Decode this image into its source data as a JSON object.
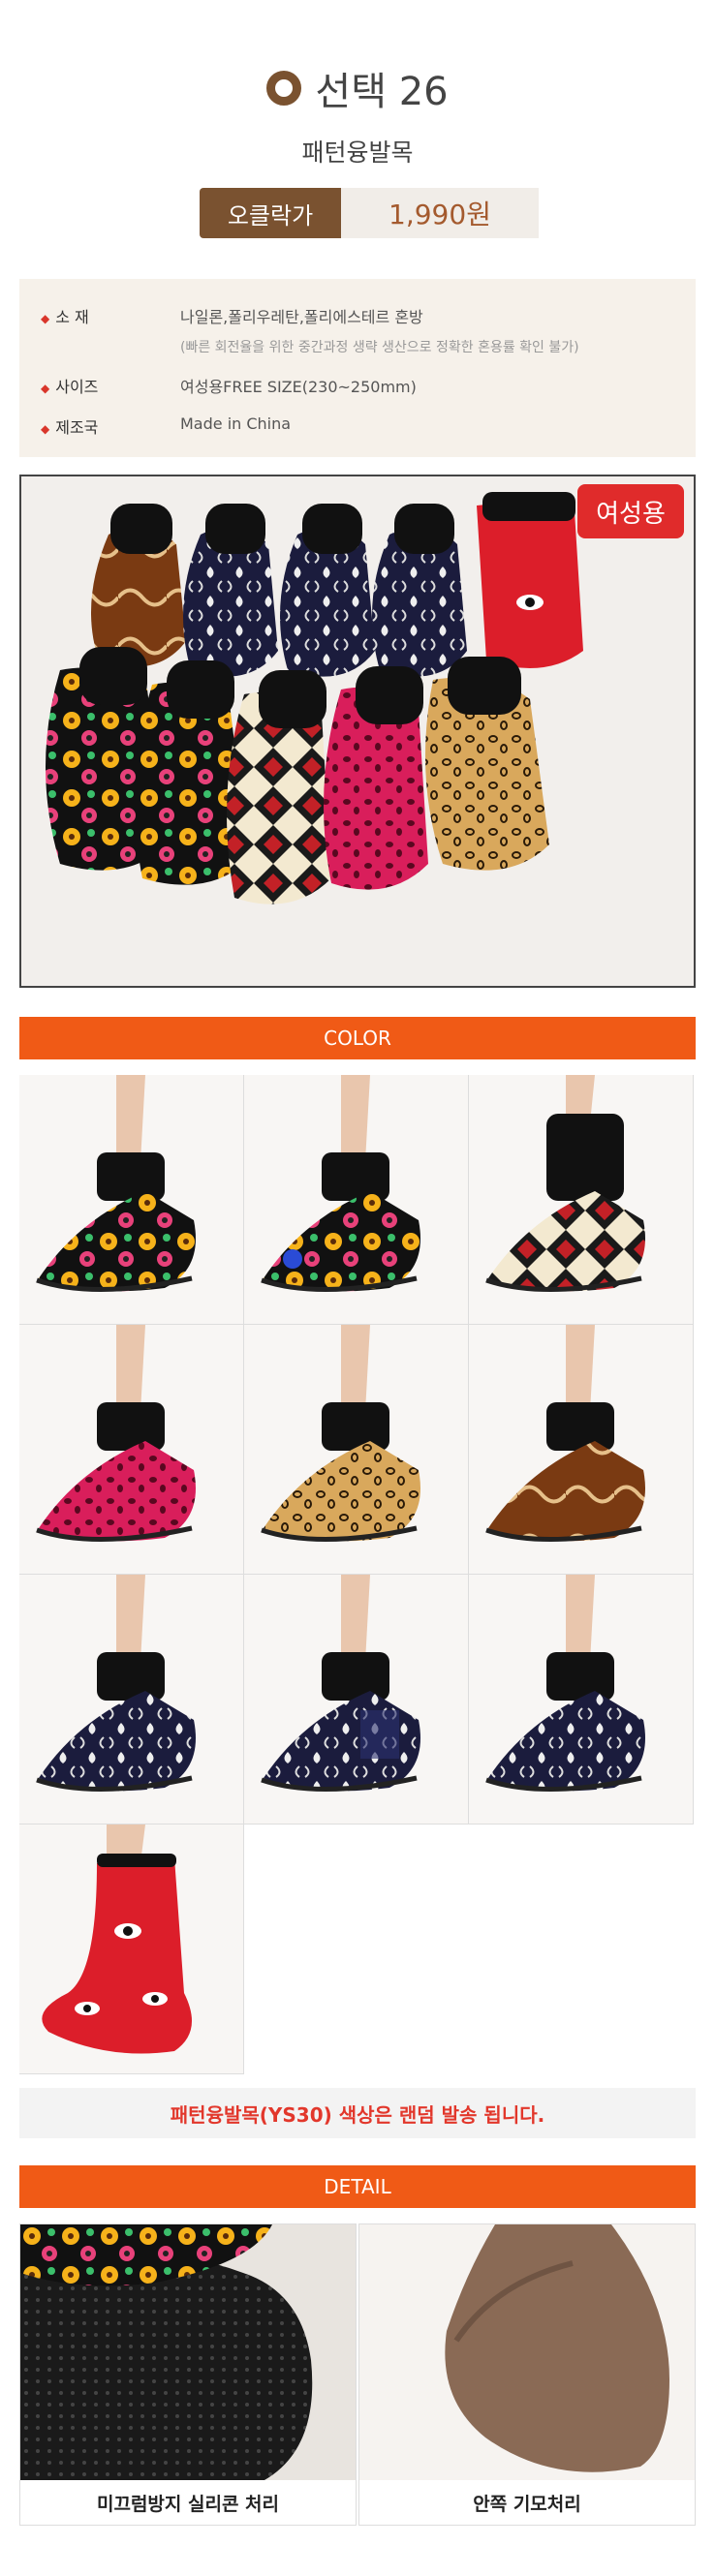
{
  "header": {
    "title": "선택 26",
    "subtitle": "패턴융발목",
    "price_label": "오클락가",
    "price_value": "1,990원"
  },
  "info": {
    "rows": [
      {
        "key": "소   재",
        "value": "나일론,폴리우레탄,폴리에스테르 혼방",
        "note": "(빠른 회전율을 위한 중간과정 생략 생산으로 정확한 혼용률 확인 불가)"
      },
      {
        "key": "사이즈",
        "value": "여성용FREE SIZE(230~250mm)"
      },
      {
        "key": "제조국",
        "value": "Made in China"
      }
    ]
  },
  "photo": {
    "tag": "여성용"
  },
  "sections": {
    "color_title": "COLOR",
    "detail_title": "DETAIL"
  },
  "notice": "패턴융발목(YS30) 색상은 랜덤 발송 됩니다.",
  "detail": {
    "left_caption": "미끄럼방지 실리콘 처리",
    "right_caption": "안쪽 기모처리"
  },
  "colors": {
    "accent": "#f05a16",
    "brand": "#7a5230",
    "notice_red": "#e2372b"
  }
}
